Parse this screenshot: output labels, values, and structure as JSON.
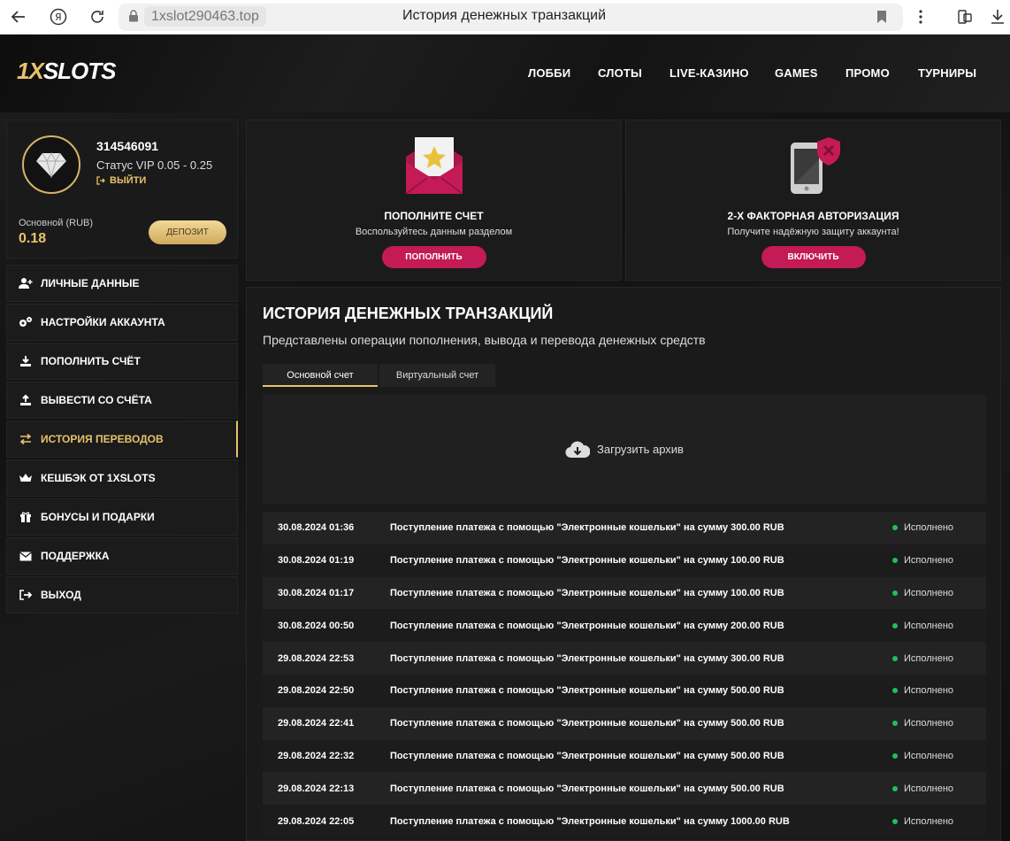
{
  "browser": {
    "host": "1xslot290463.top",
    "tab_title": "История денежных транзакций"
  },
  "header": {
    "logo_part1": "1X",
    "logo_part2": "SLOTS",
    "nav": [
      "ЛОББИ",
      "СЛОТЫ",
      "LIVE-КАЗИНО",
      "GAMES",
      "ПРОМО",
      "ТУРНИРЫ"
    ]
  },
  "profile": {
    "user_id": "314546091",
    "vip_status": "Статус VIP 0.05 - 0.25",
    "logout_label": "ВЫЙТИ",
    "balance_label": "Основной (RUB)",
    "balance_value": "0.18",
    "deposit_label": "ДЕПОЗИТ"
  },
  "sidebar": {
    "items": [
      {
        "label": "ЛИЧНЫЕ ДАННЫЕ",
        "icon": "user-plus-icon"
      },
      {
        "label": "НАСТРОЙКИ АККАУНТА",
        "icon": "gears-icon"
      },
      {
        "label": "ПОПОЛНИТЬ СЧЁТ",
        "icon": "download-icon"
      },
      {
        "label": "ВЫВЕСТИ СО СЧЁТА",
        "icon": "upload-icon"
      },
      {
        "label": "ИСТОРИЯ ПЕРЕВОДОВ",
        "icon": "transfer-icon"
      },
      {
        "label": "КЕШБЭК ОТ 1XSLOTS",
        "icon": "crown-icon"
      },
      {
        "label": "БОНУСЫ И ПОДАРКИ",
        "icon": "gift-icon"
      },
      {
        "label": "ПОДДЕРЖКА",
        "icon": "envelope-icon"
      },
      {
        "label": "ВЫХОД",
        "icon": "exit-icon"
      }
    ]
  },
  "promo_cards": [
    {
      "title": "ПОПОЛНИТЕ СЧЕТ",
      "subtitle": "Воспользуйтесь данным разделом",
      "button": "ПОПОЛНИТЬ"
    },
    {
      "title": "2-Х ФАКТОРНАЯ АВТОРИЗАЦИЯ",
      "subtitle": "Получите надёжную защиту аккаунта!",
      "button": "ВКЛЮЧИТЬ"
    }
  ],
  "history": {
    "title": "ИСТОРИЯ ДЕНЕЖНЫХ ТРАНЗАКЦИЙ",
    "subtitle": "Представлены операции пополнения, вывода и перевода денежных средств",
    "tabs": [
      "Основной счет",
      "Виртуальный счет"
    ],
    "archive_label": "Загрузить архив",
    "rows": [
      {
        "date": "30.08.2024 01:36",
        "text": "Поступление платежа с помощью \"Электронные кошельки\" на сумму 300.00 RUB",
        "status": "Исполнено"
      },
      {
        "date": "30.08.2024 01:19",
        "text": "Поступление платежа с помощью \"Электронные кошельки\" на сумму 100.00 RUB",
        "status": "Исполнено"
      },
      {
        "date": "30.08.2024 01:17",
        "text": "Поступление платежа с помощью \"Электронные кошельки\" на сумму 100.00 RUB",
        "status": "Исполнено"
      },
      {
        "date": "30.08.2024 00:50",
        "text": "Поступление платежа с помощью \"Электронные кошельки\" на сумму 200.00 RUB",
        "status": "Исполнено"
      },
      {
        "date": "29.08.2024 22:53",
        "text": "Поступление платежа с помощью \"Электронные кошельки\" на сумму 300.00 RUB",
        "status": "Исполнено"
      },
      {
        "date": "29.08.2024 22:50",
        "text": "Поступление платежа с помощью \"Электронные кошельки\" на сумму 500.00 RUB",
        "status": "Исполнено"
      },
      {
        "date": "29.08.2024 22:41",
        "text": "Поступление платежа с помощью \"Электронные кошельки\" на сумму 500.00 RUB",
        "status": "Исполнено"
      },
      {
        "date": "29.08.2024 22:32",
        "text": "Поступление платежа с помощью \"Электронные кошельки\" на сумму 500.00 RUB",
        "status": "Исполнено"
      },
      {
        "date": "29.08.2024 22:13",
        "text": "Поступление платежа с помощью \"Электронные кошельки\" на сумму 500.00 RUB",
        "status": "Исполнено"
      },
      {
        "date": "29.08.2024 22:05",
        "text": "Поступление платежа с помощью \"Электронные кошельки\" на сумму 1000.00 RUB",
        "status": "Исполнено"
      }
    ]
  },
  "colors": {
    "accent": "#e8c26a",
    "button": "#c41a55",
    "status_ok": "#1fbf5a"
  }
}
